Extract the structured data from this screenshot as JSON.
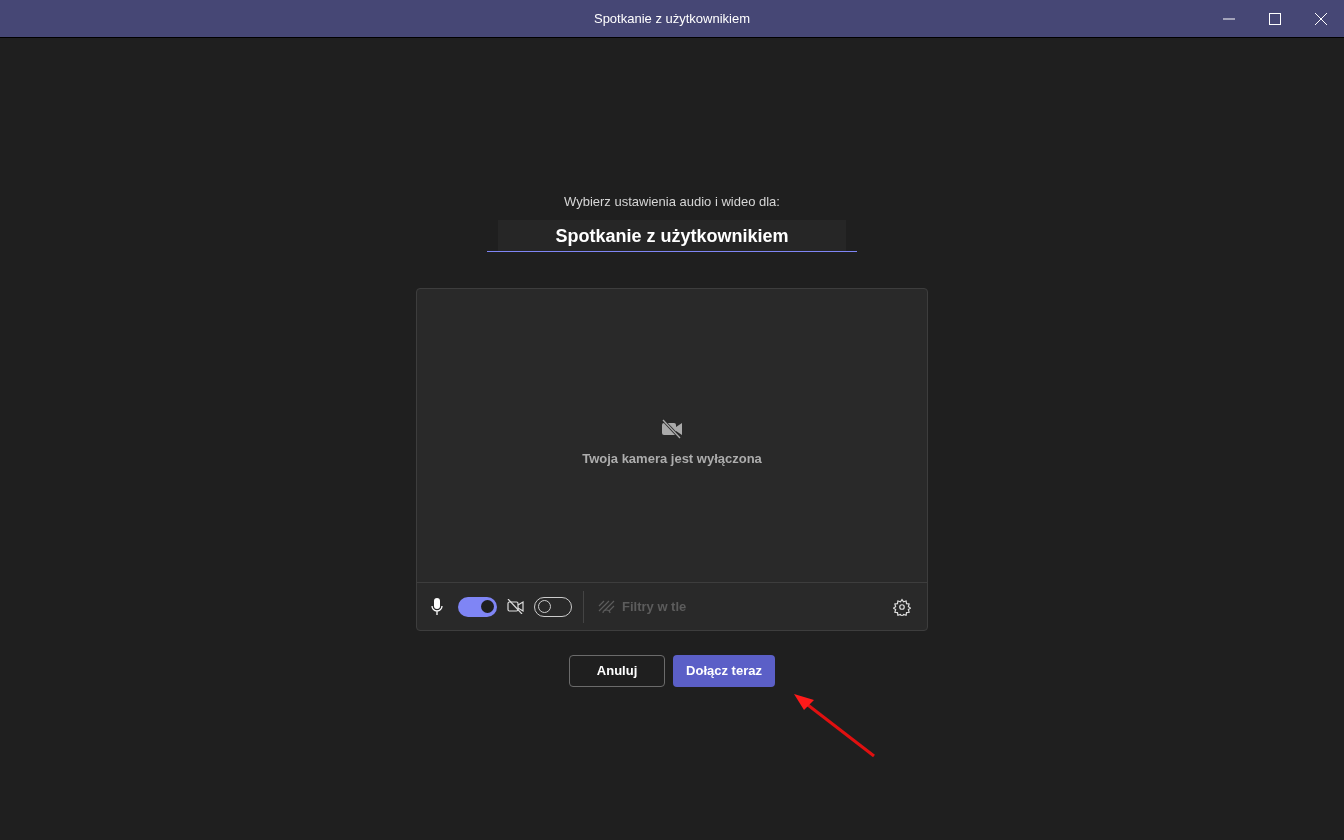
{
  "window": {
    "title": "Spotkanie z użytkownikiem"
  },
  "prompt": "Wybierz ustawienia audio i wideo dla:",
  "meeting_title": "Spotkanie z użytkownikiem",
  "preview": {
    "message": "Twoja kamera jest wyłączona"
  },
  "controls": {
    "microphone": {
      "checked": true
    },
    "camera": {
      "checked": false
    },
    "background_filters": {
      "label": "Filtry w tle",
      "disabled": true
    }
  },
  "buttons": [
    {
      "label": "Anuluj",
      "kind": "secondary"
    },
    {
      "label": "Dołącz teraz",
      "kind": "primary"
    }
  ]
}
